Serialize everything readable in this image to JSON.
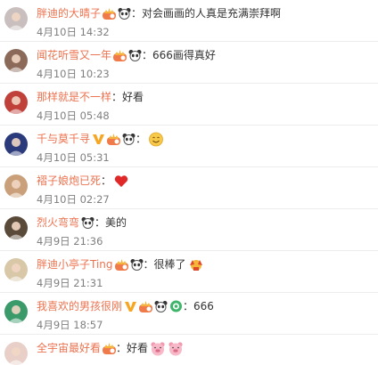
{
  "comments": [
    {
      "name": "胖迪的大晴子",
      "badges": [
        "crown-badge",
        "panda-badge"
      ],
      "text": "对会画画的人真是充满崇拜啊",
      "emoji": [],
      "time": "4月10日 14:32",
      "avatar": "#c9bfbe"
    },
    {
      "name": "闻花听雪又一年",
      "badges": [
        "crown-badge",
        "panda-badge"
      ],
      "text": "666画得真好",
      "emoji": [],
      "time": "4月10日 10:23",
      "avatar": "#8c6a5a"
    },
    {
      "name": "那样就是不一样",
      "badges": [],
      "text": "好看",
      "emoji": [],
      "time": "4月10日 05:48",
      "avatar": "#c0403a"
    },
    {
      "name": "千与莫千寻",
      "badges": [
        "v-badge",
        "crown-badge",
        "panda-badge"
      ],
      "text": "",
      "emoji": [
        "smile-emoji"
      ],
      "time": "4月10日 05:31",
      "avatar": "#2a3a7a"
    },
    {
      "name": "褶子娘炮已死",
      "badges": [],
      "text": "",
      "emoji": [
        "heart-emoji"
      ],
      "time": "4月10日 02:27",
      "avatar": "#caa07a"
    },
    {
      "name": "烈火弯弯",
      "badges": [
        "panda-badge"
      ],
      "text": "美的",
      "emoji": [],
      "time": "4月9日 21:36",
      "avatar": "#5a4a3a"
    },
    {
      "name": "胖迪小亭子Ting",
      "badges": [
        "crown-badge",
        "panda-badge"
      ],
      "text": "很棒了",
      "emoji": [
        "cheer-emoji"
      ],
      "time": "4月9日 21:31",
      "avatar": "#d9c8a8"
    },
    {
      "name": "我喜欢的男孩很刚",
      "badges": [
        "v-badge",
        "crown-badge",
        "panda-badge",
        "green-badge"
      ],
      "text": "666",
      "emoji": [],
      "time": "4月9日 18:57",
      "avatar": "#3a9a6a"
    },
    {
      "name": "全宇宙最好看",
      "badges": [
        "crown-badge"
      ],
      "text": "好看",
      "emoji": [
        "pig-emoji",
        "pig-emoji"
      ],
      "time": "",
      "avatar": "#e8d0c8"
    }
  ],
  "colon": "：",
  "colors": {
    "name": "#eb7350",
    "text": "#333333",
    "time": "#808080",
    "badge_v": "#f6a623",
    "heart": "#e02828"
  }
}
